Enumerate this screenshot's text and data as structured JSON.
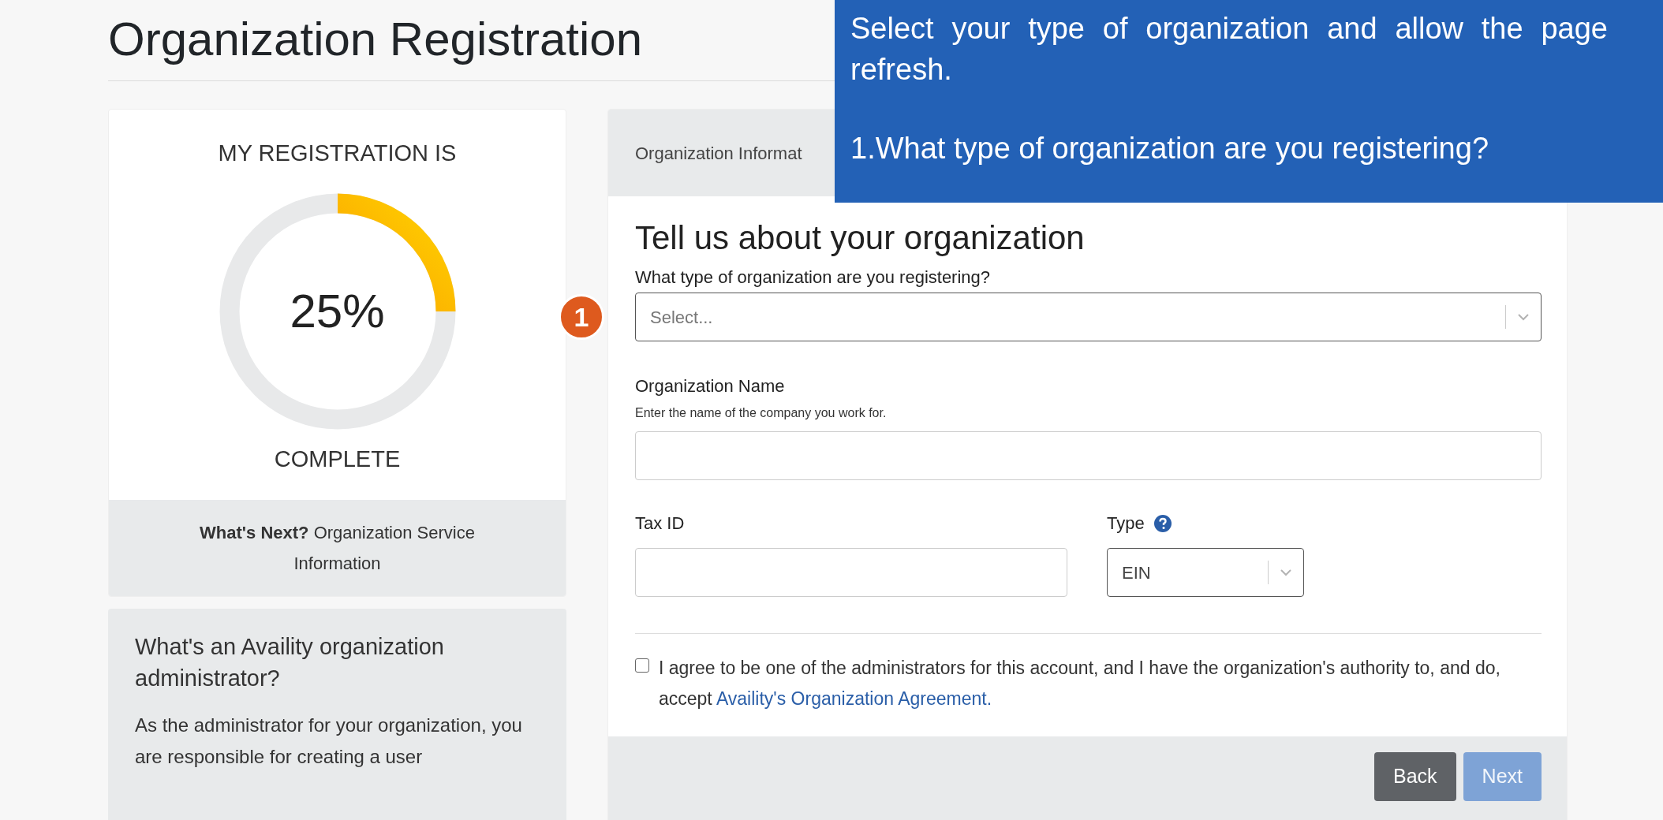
{
  "page_title": "Organization Registration",
  "progress": {
    "heading": "MY REGISTRATION IS",
    "percent": "25%",
    "level": 0.25,
    "caption": "COMPLETE",
    "next": "**What's Next?** Organization Service Information"
  },
  "admin_info": {
    "title": "What's an Availity organization administrator?",
    "body": "As the administrator for your organization, you are responsible for creating a user"
  },
  "form": {
    "header": "Organization Informat",
    "title": "Tell us about your organization",
    "org_type": {
      "label": "What type of organization are you registering?",
      "placeholder": "Select..."
    },
    "org_name": {
      "label": "Organization Name",
      "help": "Enter the name of the company you work for."
    },
    "tax_id": {
      "label": "Tax ID"
    },
    "id_type": {
      "label": "Type",
      "value": "EIN"
    },
    "agreement": {
      "checked": false,
      "text": "I agree to be one of the administrators for this account, and I have the organization's authority to, and do, accept ",
      "link": "Availity's Organization Agreement."
    },
    "buttons": [
      {
        "label": "Back",
        "kind": "secondary",
        "disabled": false
      },
      {
        "label": "Next",
        "kind": "primary",
        "disabled": true
      }
    ]
  },
  "callout": {
    "marker": "1",
    "text": "Select your type of organization and allow the page refresh.",
    "question": "1.What type of organization are you registering?"
  }
}
